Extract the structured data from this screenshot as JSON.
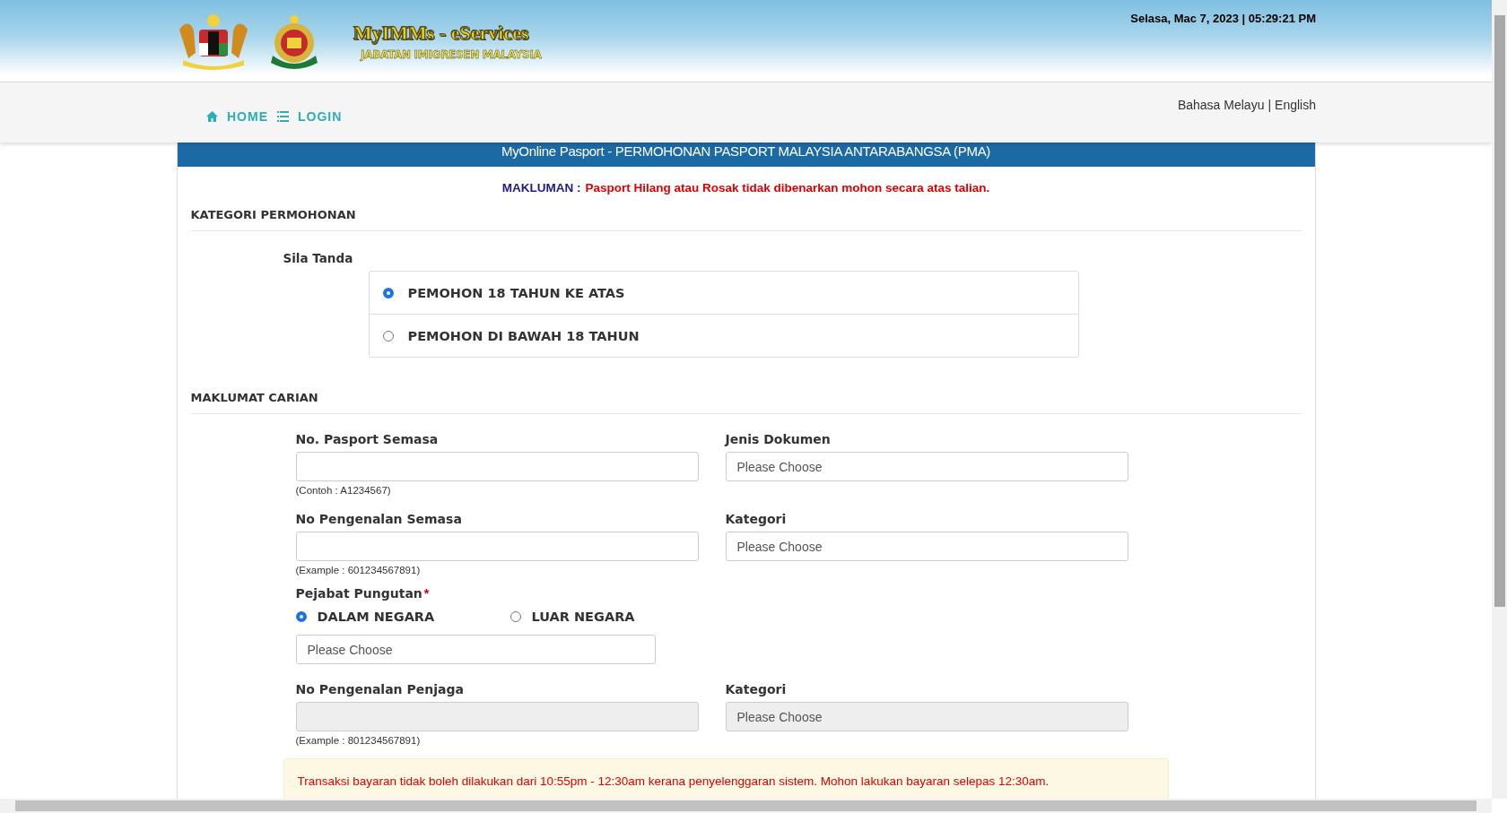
{
  "header": {
    "logo_title": "MyIMMs - eServices",
    "logo_subtitle": "JABATAN IMIGRESEN MALAYSIA",
    "datetime": "Selasa, Mac 7, 2023 | 05:29:21 PM"
  },
  "nav": {
    "items": [
      {
        "label": "HOME",
        "kind": "home"
      },
      {
        "label": "LOGIN",
        "kind": "list"
      }
    ],
    "languages": [
      "Bahasa Melayu",
      "English"
    ],
    "language_separator": "|"
  },
  "page_title": "MyOnline Pasport - PERMOHONAN PASPORT MALAYSIA ANTARABANGSA (PMA)",
  "notice": {
    "label": "MAKLUMAN :",
    "message": "Pasport Hilang atau Rosak tidak dibenarkan mohon secara atas talian."
  },
  "category_section": {
    "heading": "KATEGORI PERMOHONAN",
    "prompt": "Sila Tanda",
    "options": [
      {
        "label": "PEMOHON 18 TAHUN KE ATAS",
        "selected": true
      },
      {
        "label": "PEMOHON DI BAWAH 18 TAHUN",
        "selected": false
      }
    ]
  },
  "search_section": {
    "heading": "MAKLUMAT CARIAN",
    "rows": [
      [
        {
          "kind": "text",
          "label": "No. Pasport Semasa",
          "hint": "(Contoh : A1234567)",
          "disabled": false
        },
        {
          "kind": "select",
          "label": "Jenis Dokumen",
          "placeholder": "Please Choose",
          "disabled": false
        }
      ],
      [
        {
          "kind": "text",
          "label": "No Pengenalan Semasa",
          "hint": "(Example : 601234567891)",
          "disabled": false
        },
        {
          "kind": "select",
          "label": "Kategori",
          "placeholder": "Please Choose",
          "disabled": false
        }
      ]
    ],
    "office": {
      "label": "Pejabat Pungutan",
      "required_mark": "*",
      "options": [
        {
          "label": "DALAM NEGARA",
          "selected": true
        },
        {
          "label": "LUAR NEGARA",
          "selected": false
        }
      ],
      "placeholder": "Please Choose"
    },
    "guardian_row": [
      {
        "kind": "text",
        "label": "No Pengenalan Penjaga",
        "hint": "(Example : 801234567891)",
        "disabled": true
      },
      {
        "kind": "select",
        "label": "Kategori",
        "placeholder": "Please Choose",
        "disabled": true
      }
    ]
  },
  "payment_notice": "Transaksi bayaran tidak boleh dilakukan dari 10:55pm - 12:30am kerana penyelenggaran sistem. Mohon lakukan bayaran selepas 12:30am."
}
